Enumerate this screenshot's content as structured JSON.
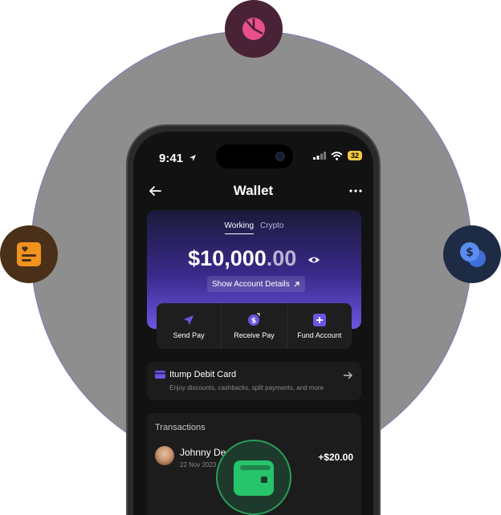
{
  "status": {
    "time": "9:41",
    "battery": "32"
  },
  "header": {
    "title": "Wallet"
  },
  "balance": {
    "tabs": [
      {
        "label": "Working"
      },
      {
        "label": "Crypto"
      }
    ],
    "amount_main": "$10,000",
    "amount_decimal": ".00",
    "details_label": "Show Account Details"
  },
  "actions": [
    {
      "label": "Send Pay"
    },
    {
      "label": "Receive Pay"
    },
    {
      "label": "Fund Account"
    }
  ],
  "debit_card": {
    "title": "Itump Debit Card",
    "subtitle": "Enjoy discounts, cashbacks, split payments, and more"
  },
  "transactions": {
    "title": "Transactions",
    "items": [
      {
        "name": "Johnny Deo",
        "date": "22 Nov 2023",
        "amount": "+$20.00"
      }
    ]
  },
  "colors": {
    "accent": "#6d55e0",
    "pie_orbit": "#4a2236",
    "pie_icon": "#e8508a",
    "list_orbit": "#4a3018",
    "list_icon": "#f0931e",
    "coins_orbit": "#1d2b45",
    "coins_icon": "#5b8cf0",
    "wallet_orbit": "#1e3a2c",
    "wallet_icon": "#27c46b"
  }
}
